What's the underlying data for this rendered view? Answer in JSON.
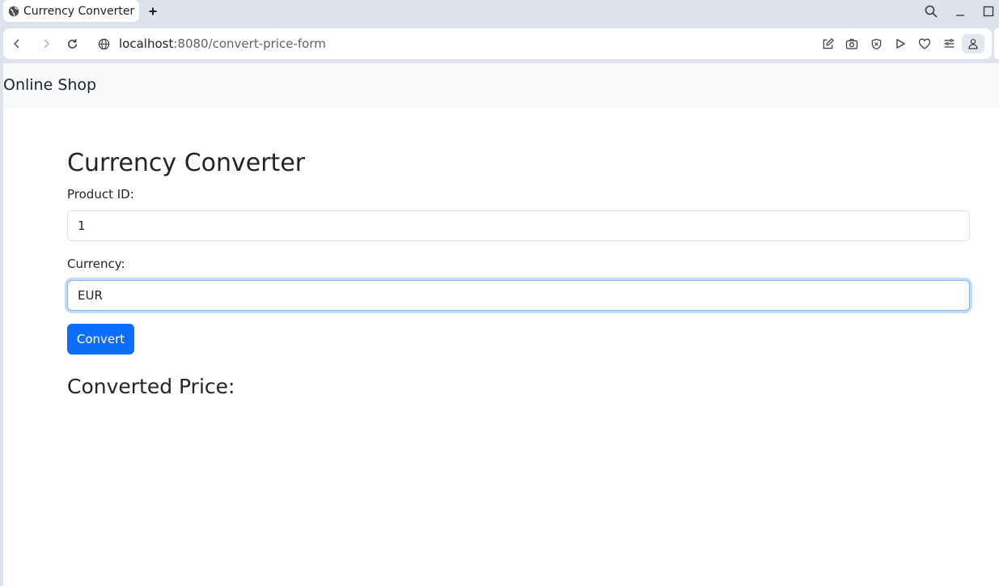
{
  "browser": {
    "tab_title": "Currency Converter",
    "url_host": "localhost",
    "url_rest": ":8080/convert-price-form"
  },
  "navbar": {
    "brand": "Online Shop"
  },
  "form": {
    "heading": "Currency Converter",
    "product_id_label": "Product ID:",
    "product_id_value": "1",
    "currency_label": "Currency:",
    "currency_value": "EUR",
    "submit_label": "Convert"
  },
  "result": {
    "heading": "Converted Price:"
  },
  "colors": {
    "primary": "#0d6efd",
    "navbar_bg": "#f8f9fa",
    "browser_frame": "#dde3ea"
  },
  "icons": {
    "tab": "globe-icon",
    "toolbar": [
      "back-icon",
      "forward-icon",
      "reload-icon",
      "site-info-icon",
      "edit-icon",
      "camera-icon",
      "shield-icon",
      "play-icon",
      "heart-icon",
      "menu-icon",
      "profile-icon"
    ],
    "window": [
      "search-icon",
      "minimize-icon",
      "maximize-icon"
    ]
  }
}
